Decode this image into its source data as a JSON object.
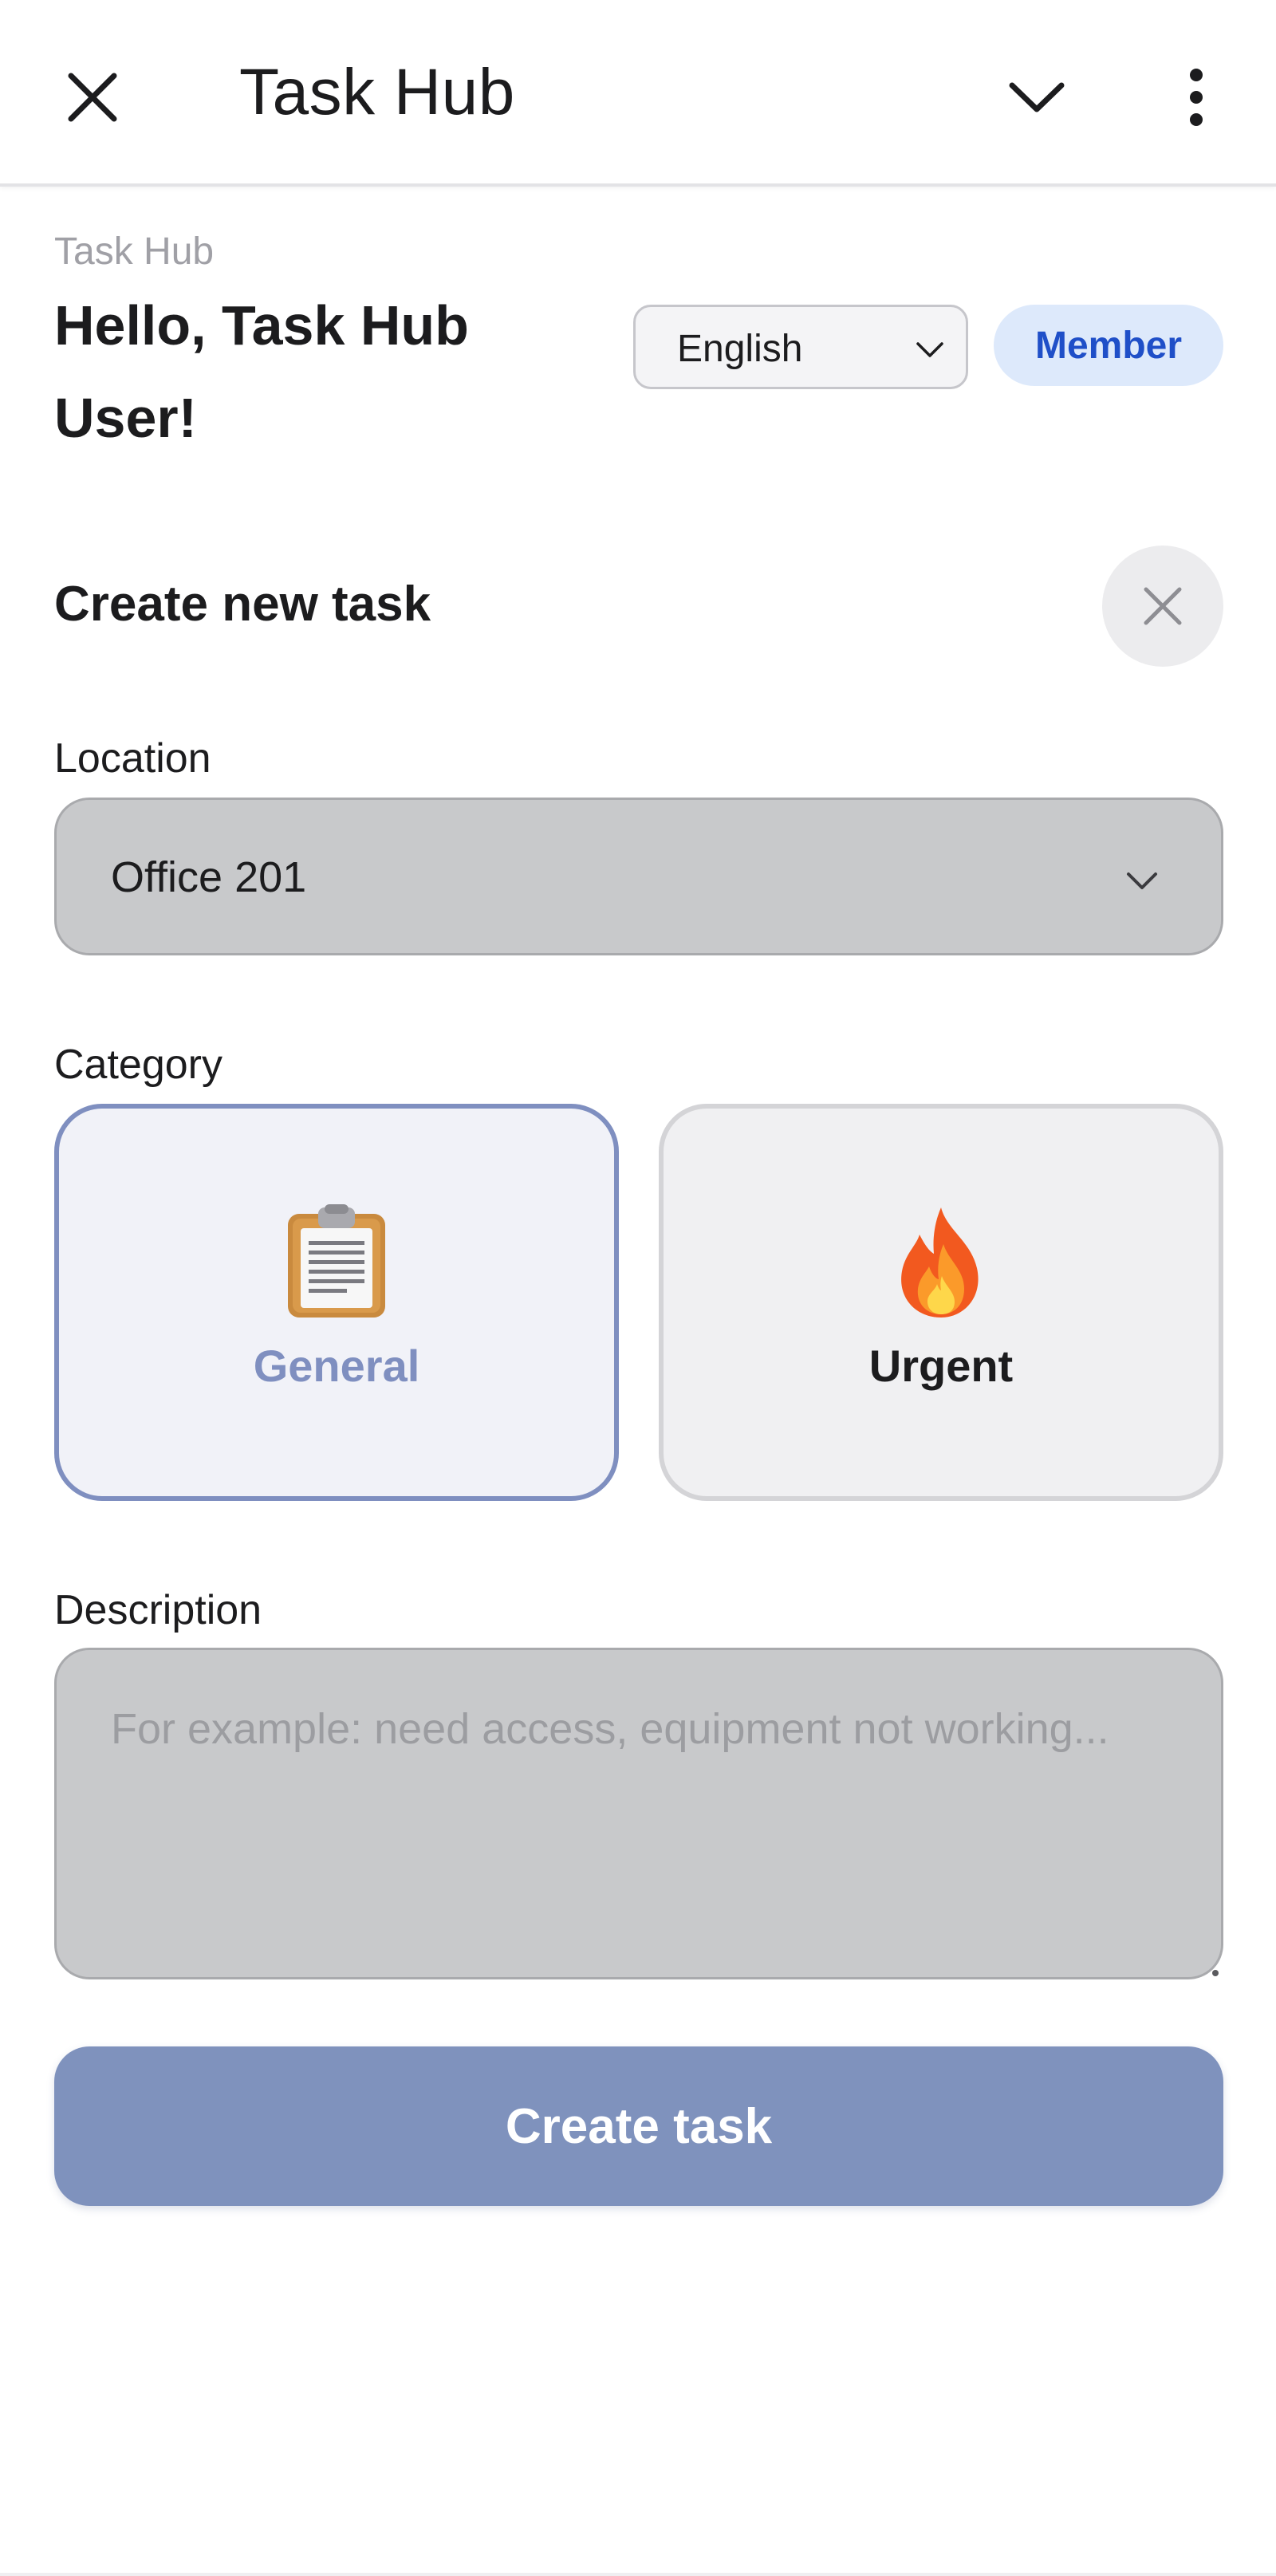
{
  "app_bar": {
    "title": "Task Hub",
    "close_icon": "close-icon",
    "collapse_icon": "chevron-down-icon",
    "menu_icon": "more-vertical-icon"
  },
  "header": {
    "breadcrumb": "Task Hub",
    "greeting": "Hello, Task Hub User!",
    "language": {
      "selected": "English",
      "icon": "chevron-down-icon"
    },
    "role_badge": "Member"
  },
  "form": {
    "title": "Create new task",
    "close_icon": "close-icon",
    "location": {
      "label": "Location",
      "selected": "Office 201",
      "icon": "chevron-down-icon"
    },
    "category": {
      "label": "Category",
      "options": [
        {
          "label": "General",
          "icon": "clipboard-icon",
          "selected": true
        },
        {
          "label": "Urgent",
          "icon": "fire-icon",
          "selected": false
        }
      ]
    },
    "description": {
      "label": "Description",
      "value": "",
      "placeholder": "For example: need access, equipment not working..."
    },
    "submit_label": "Create task"
  },
  "colors": {
    "accent": "#7f92bd",
    "badge_bg": "#dde9fb",
    "badge_text": "#1f4fc8",
    "selected_border": "#7f8fc0",
    "field_bg": "#c8c9cb"
  }
}
